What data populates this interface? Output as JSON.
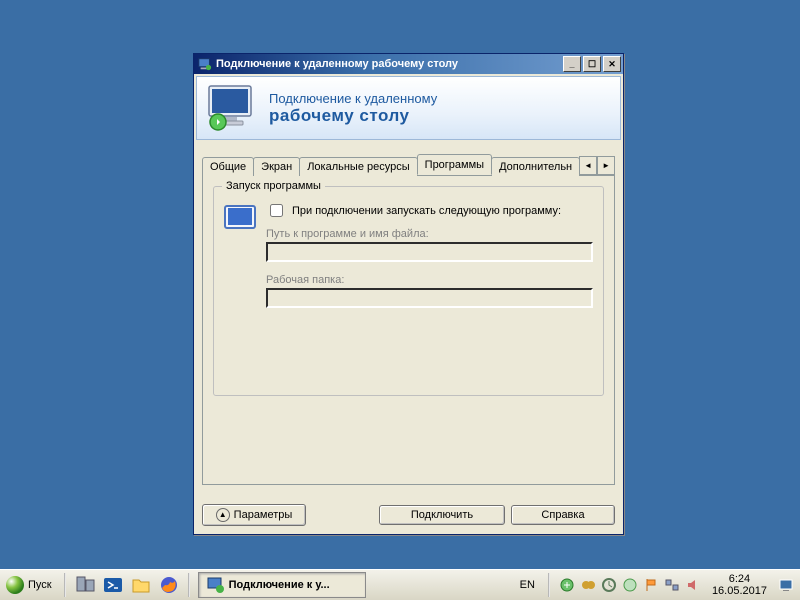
{
  "window": {
    "title": "Подключение к удаленному рабочему столу",
    "banner_line1": "Подключение к удаленному",
    "banner_line2": "рабочему столу"
  },
  "tabs": {
    "items": [
      "Общие",
      "Экран",
      "Локальные ресурсы",
      "Программы",
      "Дополнительн"
    ],
    "active_index": 3
  },
  "programs_tab": {
    "group_title": "Запуск программы",
    "checkbox_label": "При подключении запускать следующую программу:",
    "path_label": "Путь к программе и имя файла:",
    "path_value": "",
    "folder_label": "Рабочая папка:",
    "folder_value": ""
  },
  "buttons": {
    "options": "Параметры",
    "connect": "Подключить",
    "help": "Справка"
  },
  "taskbar": {
    "start": "Пуск",
    "active_task": "Подключение к у...",
    "lang": "EN",
    "time": "6:24",
    "date": "16.05.2017"
  }
}
